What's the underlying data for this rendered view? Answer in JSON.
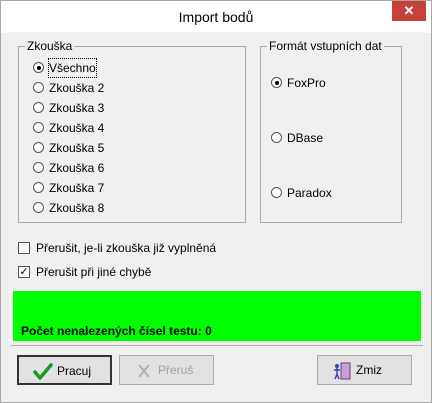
{
  "window": {
    "title": "Import bodů",
    "close_glyph": "✕"
  },
  "test_group": {
    "label": "Zkouška",
    "options": [
      {
        "label": "Všechno",
        "selected": true
      },
      {
        "label": "Zkouška 2",
        "selected": false
      },
      {
        "label": "Zkouška 3",
        "selected": false
      },
      {
        "label": "Zkouška 4",
        "selected": false
      },
      {
        "label": "Zkouška 5",
        "selected": false
      },
      {
        "label": "Zkouška 6",
        "selected": false
      },
      {
        "label": "Zkouška 7",
        "selected": false
      },
      {
        "label": "Zkouška 8",
        "selected": false
      }
    ]
  },
  "format_group": {
    "label": "Formát vstupních dat",
    "options": [
      {
        "label": "FoxPro",
        "selected": true
      },
      {
        "label": "DBase",
        "selected": false
      },
      {
        "label": "Paradox",
        "selected": false
      }
    ]
  },
  "checkboxes": [
    {
      "label": "Přerušit, je-li zkouška již vyplněná",
      "checked": false
    },
    {
      "label": "Přerušit při jiné chybě",
      "checked": true
    }
  ],
  "status": {
    "text": "Počet nenalezených čísel testu: 0",
    "color": "#00ff00"
  },
  "buttons": {
    "run": {
      "label": "Pracuj",
      "icon": "check-icon"
    },
    "stop": {
      "label": "Přeruš",
      "icon": "x-icon"
    },
    "close": {
      "label": "Zmiz",
      "icon": "door-exit-icon"
    }
  }
}
